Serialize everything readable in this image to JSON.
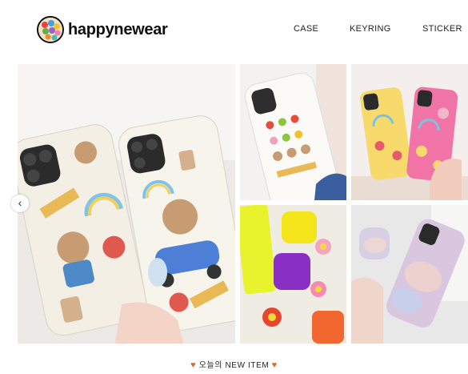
{
  "header": {
    "logo_text": "happynewear",
    "nav": [
      "CASE",
      "KEYRING",
      "STICKER"
    ]
  },
  "gallery": {
    "prev_arrow": "‹"
  },
  "caption": {
    "heart_left": "♥",
    "text": "오늘의 NEW ITEM",
    "heart_right": "♥"
  },
  "colors": {
    "accent_heart": "#e56a1f",
    "text": "#222222"
  }
}
